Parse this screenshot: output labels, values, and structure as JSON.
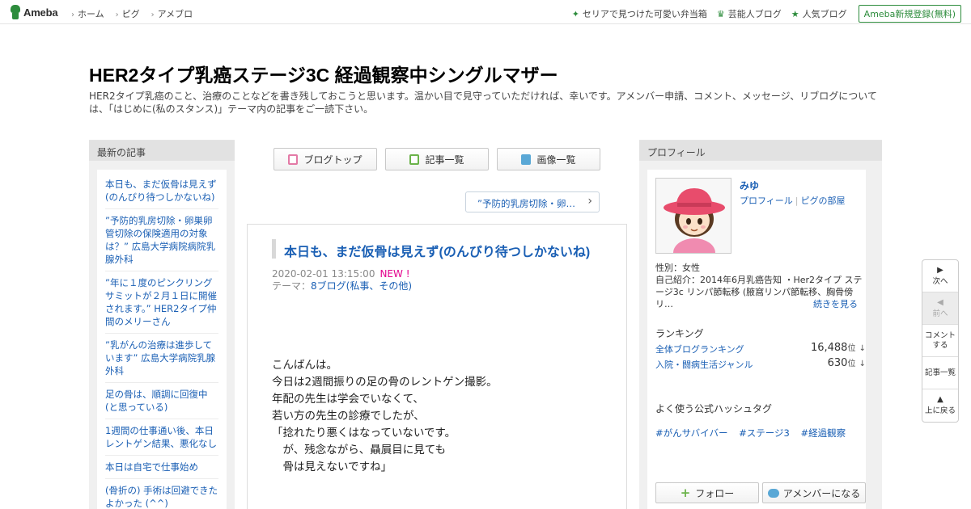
{
  "header": {
    "logo": "Ameba",
    "nav": [
      "ホーム",
      "ピグ",
      "アメブロ"
    ],
    "right_links": [
      {
        "label": "セリアで見つけた可愛い弁当箱",
        "icon": "sparkle-icon"
      },
      {
        "label": "芸能人ブログ",
        "icon": "crown-icon"
      },
      {
        "label": "人気ブログ",
        "icon": "star-icon"
      }
    ],
    "register": "Ameba新規登録(無料)"
  },
  "blog": {
    "title": "HER2タイプ乳癌ステージ3C 経過観察中シングルマザー",
    "description": "HER2タイプ乳癌のこと、治療のことなどを書き残しておこうと思います。温かい目で見守っていただければ、幸いです。アメンバー申請、コメント、メッセージ、リブログについては、「はじめに(私のスタンス)」テーマ内の記事をご一読下さい。"
  },
  "left": {
    "heading": "最新の記事",
    "items": [
      "本日も、まだ仮骨は見えず(のんびり待つしかないね)",
      "”予防的乳房切除・卵巣卵管切除の保険適用の対象は？” 広島大学病院病院乳腺外科",
      "”年に１度のピンクリングサミットが２月１日に開催されます。” HER2タイプ仲間のメリーさん",
      "”乳がんの治療は進歩しています” 広島大学病院乳腺外科",
      "足の骨は、順調に回復中(と思っている)",
      "1週間の仕事通い後、本日レントゲン結果、悪化なし",
      "本日は自宅で仕事始め",
      "(骨折の) 手術は回避できた よかった (^^)"
    ]
  },
  "toolbar": {
    "blog_top": "ブログトップ",
    "entry_list": "記事一覧",
    "image_list": "画像一覧"
  },
  "prev_entry": "”予防的乳房切除・卵…",
  "article": {
    "title": "本日も、まだ仮骨は見えず(のんびり待つしかないね)",
    "date": "2020-02-01 13:15:00",
    "new": "NEW !",
    "theme_label": "テーマ：",
    "theme": "8ブログ(私事、その他)",
    "body": [
      "こんばんは。",
      "",
      "今日は2週間振りの足の骨のレントゲン撮影。",
      "年配の先生は学会でいなくて、",
      "若い方の先生の診療でしたが、",
      "",
      "「捻れたり悪くはなっていないです。",
      "　が、残念ながら、贔屓目に見ても",
      "　骨は見えないですね」"
    ]
  },
  "profile": {
    "heading": "プロフィール",
    "name": "みゆ",
    "link_profile": "プロフィール",
    "link_room": "ピグの部屋",
    "gender": "性別：女性",
    "intro": "自己紹介：2014年6月乳癌告知 ・Her2タイプ ステージ3c リンパ節転移 (腋窩リンパ節転移、胸骨傍リ…",
    "more": "続きを見る",
    "ranking_heading": "ランキング",
    "ranking": [
      {
        "name": "全体ブログランキング",
        "value": "16,488",
        "unit": "位",
        "arrow": "↓"
      },
      {
        "name": "入院・闘病生活ジャンル",
        "value": "630",
        "unit": "位",
        "arrow": "↓"
      }
    ],
    "tags_heading": "よく使う公式ハッシュタグ",
    "tags": [
      "#がんサバイバー",
      "#ステージ3",
      "#経過観察"
    ],
    "follow": "フォロー",
    "amember": "アメンバーになる"
  },
  "side_menu": {
    "next": "次へ",
    "prev": "前へ",
    "comment_1": "コメント",
    "comment_2": "する",
    "list": "記事一覧",
    "top": "上に戻る"
  }
}
